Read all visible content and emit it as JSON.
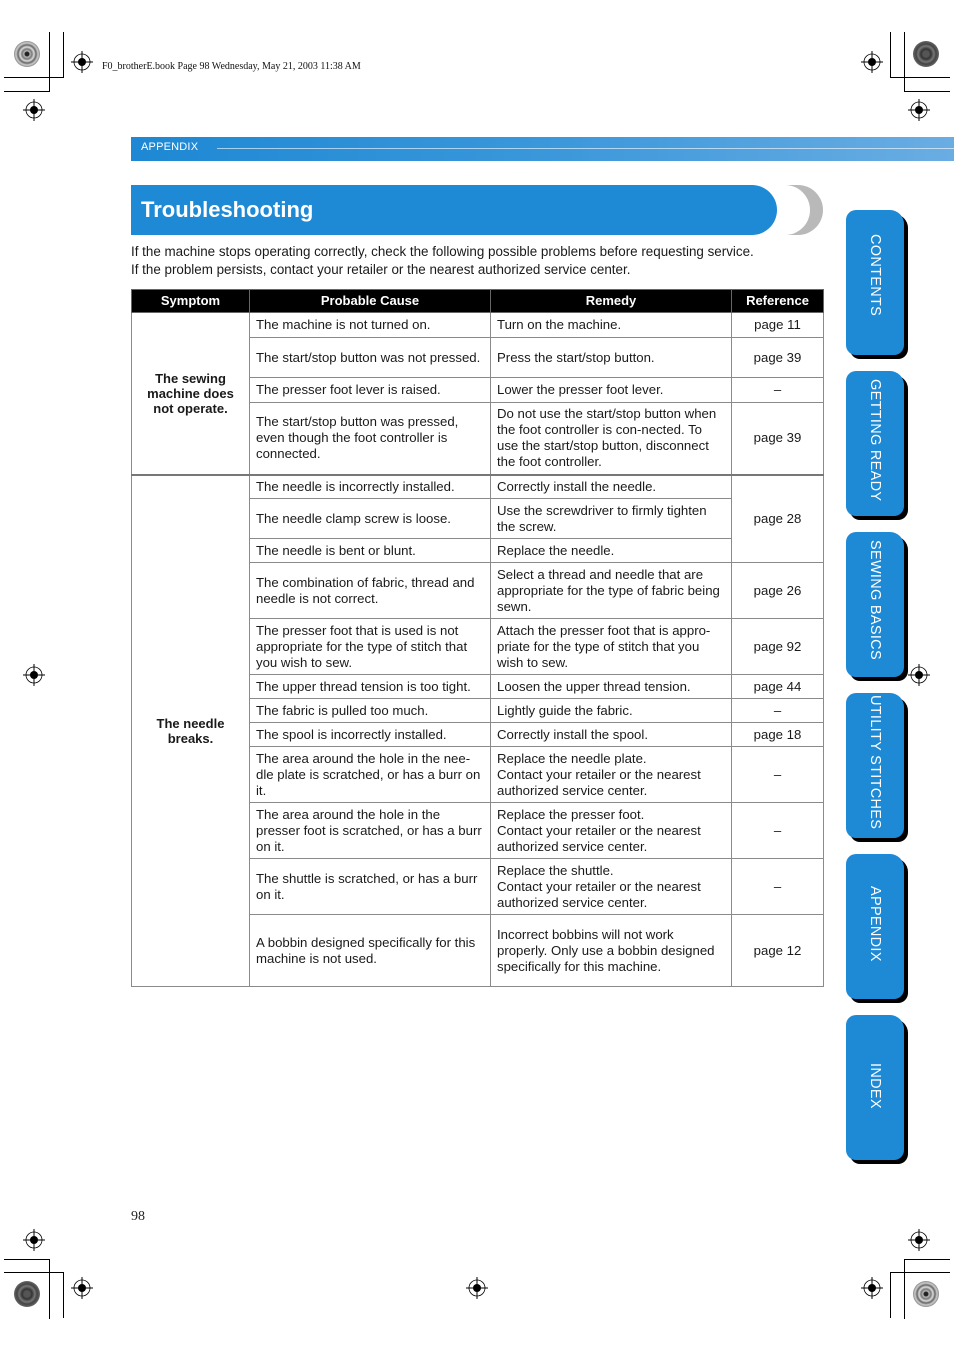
{
  "print_info": "F0_brotherE.book  Page 98  Wednesday, May 21, 2003  11:38 AM",
  "section_header": "APPENDIX",
  "title": "Troubleshooting",
  "intro": [
    "If the machine stops operating correctly, check the following possible problems before requesting service.",
    "If the problem persists, contact your retailer or the nearest authorized service center."
  ],
  "table": {
    "headers": [
      "Symptom",
      "Probable Cause",
      "Remedy",
      "Reference"
    ],
    "groups": [
      {
        "symptom": "The sewing machine does not operate.",
        "rows": [
          {
            "cause": "The machine is not turned on.",
            "remedy": "Turn on the machine.",
            "reference": "page 11"
          },
          {
            "cause": "The start/stop button was not pressed.",
            "remedy": "Press the start/stop button.",
            "reference": "page 39"
          },
          {
            "cause": "The presser foot lever is raised.",
            "remedy": "Lower the presser foot lever.",
            "reference": "–"
          },
          {
            "cause": "The start/stop button was pressed, even though the foot controller is connected.",
            "remedy": "Do not use the start/stop button when the foot controller is con-nected. To use the start/stop button, disconnect the foot controller.",
            "reference": "page 39"
          }
        ]
      },
      {
        "symptom": "The needle breaks.",
        "rows": [
          {
            "cause": "The needle is incorrectly installed.",
            "remedy": "Correctly install the needle.",
            "reference": "page 28"
          },
          {
            "cause": "The needle clamp screw is loose.",
            "remedy": "Use the screwdriver to firmly tighten the screw.",
            "reference": ""
          },
          {
            "cause": "The needle is bent or blunt.",
            "remedy": "Replace the needle.",
            "reference": ""
          },
          {
            "cause": "The combination of fabric, thread and needle is not correct.",
            "remedy": "Select a thread and needle that are appropriate for the type of fabric being sewn.",
            "reference": "page 26"
          },
          {
            "cause": "The presser foot that is used is not appropriate for the type of stitch that you wish to sew.",
            "remedy": "Attach the presser foot that is appro-priate for the type of stitch that you wish to sew.",
            "reference": "page 92"
          },
          {
            "cause": "The upper thread tension is too tight.",
            "remedy": "Loosen the upper thread tension.",
            "reference": "page 44"
          },
          {
            "cause": "The fabric is pulled too much.",
            "remedy": "Lightly guide the fabric.",
            "reference": "–"
          },
          {
            "cause": "The spool is incorrectly installed.",
            "remedy": "Correctly install the spool.",
            "reference": "page 18"
          },
          {
            "cause": "The area around the hole in the nee-dle plate is scratched, or has a burr on it.",
            "remedy": "Replace the needle plate.\nContact your retailer or the nearest authorized service center.",
            "reference": "–"
          },
          {
            "cause": "The area around the hole in the presser foot is scratched, or has a burr on it.",
            "remedy": "Replace the presser foot.\nContact your retailer or the nearest authorized service center.",
            "reference": "–"
          },
          {
            "cause": "The shuttle is scratched, or has a burr on it.",
            "remedy": "Replace the shuttle.\nContact your retailer or the nearest authorized service center.",
            "reference": "–"
          },
          {
            "cause": "A bobbin designed specifically for this machine is not used.",
            "remedy": "Incorrect bobbins will not work properly. Only use a bobbin designed specifically for this machine.",
            "reference": "page 12"
          }
        ]
      }
    ]
  },
  "side_tabs": [
    "CONTENTS",
    "GETTING READY",
    "SEWING BASICS",
    "UTILITY STITCHES",
    "APPENDIX",
    "INDEX"
  ],
  "page_number": "98",
  "colors": {
    "brand_blue": "#1e8ad6",
    "header_black": "#000000"
  }
}
